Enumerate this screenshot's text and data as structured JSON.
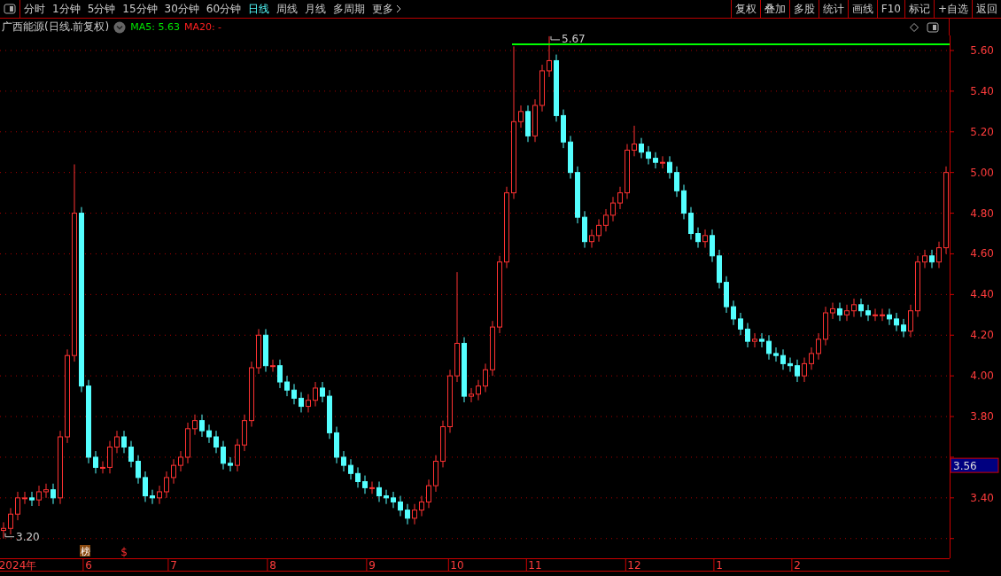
{
  "toolbar": {
    "periods": [
      {
        "label": "分时",
        "selected": false
      },
      {
        "label": "1分钟",
        "selected": false
      },
      {
        "label": "5分钟",
        "selected": false
      },
      {
        "label": "15分钟",
        "selected": false
      },
      {
        "label": "30分钟",
        "selected": false
      },
      {
        "label": "60分钟",
        "selected": false
      },
      {
        "label": "日线",
        "selected": true
      },
      {
        "label": "周线",
        "selected": false
      },
      {
        "label": "月线",
        "selected": false
      },
      {
        "label": "多周期",
        "selected": false
      }
    ],
    "more": "更多",
    "actions": [
      "复权",
      "叠加",
      "多股",
      "统计",
      "画线",
      "F10",
      "标记",
      "+自选",
      "返回"
    ]
  },
  "header": {
    "title": "广西能源(日线.前复权)",
    "indicators": [
      {
        "label": "MA5: 5.63",
        "color": "#00e600"
      },
      {
        "label": "MA20: -",
        "color": "#ff2020"
      }
    ]
  },
  "chart": {
    "chart_data": {
      "type": "candlestick",
      "grid": true,
      "ylim": [
        3.103,
        5.674
      ],
      "yticks": [
        {
          "value": 3.4,
          "label": "3.40"
        },
        {
          "value": 3.8,
          "label": "3.80"
        },
        {
          "value": 4.0,
          "label": "4.00"
        },
        {
          "value": 4.2,
          "label": "4.20"
        },
        {
          "value": 4.4,
          "label": "4.40"
        },
        {
          "value": 4.6,
          "label": "4.60"
        },
        {
          "value": 4.8,
          "label": "4.80"
        },
        {
          "value": 5.0,
          "label": "5.00"
        },
        {
          "value": 5.2,
          "label": "5.20"
        },
        {
          "value": 5.4,
          "label": "5.40"
        },
        {
          "value": 5.6,
          "label": "5.60"
        }
      ],
      "categories": [
        null,
        null,
        "2024年",
        null,
        null,
        null,
        null,
        null,
        null,
        null,
        null,
        null,
        "6",
        null,
        null,
        null,
        null,
        null,
        null,
        null,
        null,
        null,
        null,
        null,
        "7",
        null,
        null,
        null,
        null,
        null,
        null,
        null,
        null,
        null,
        null,
        null,
        null,
        null,
        "8",
        null,
        null,
        null,
        null,
        null,
        null,
        null,
        null,
        null,
        null,
        null,
        null,
        null,
        "9",
        null,
        null,
        null,
        null,
        null,
        null,
        null,
        null,
        null,
        null,
        null,
        "10",
        null,
        null,
        null,
        null,
        null,
        null,
        null,
        null,
        null,
        null,
        "11",
        null,
        null,
        null,
        null,
        null,
        null,
        null,
        null,
        null,
        null,
        null,
        null,
        null,
        "12",
        null,
        null,
        null,
        null,
        null,
        null,
        null,
        null,
        null,
        null,
        null,
        "1",
        null,
        null,
        null,
        null,
        null,
        null,
        null,
        null,
        null,
        null,
        "2",
        null,
        null,
        null,
        null,
        null,
        null,
        null,
        null,
        null,
        null,
        null,
        null,
        null,
        null,
        null,
        null,
        null,
        null,
        null,
        null,
        null
      ],
      "ohlc": [
        [
          3.24,
          3.28,
          3.2,
          3.25
        ],
        [
          3.25,
          3.35,
          3.22,
          3.32
        ],
        [
          3.32,
          3.43,
          3.29,
          3.4
        ],
        [
          3.4,
          3.43,
          3.37,
          3.4
        ],
        [
          3.4,
          3.43,
          3.36,
          3.39
        ],
        [
          3.39,
          3.46,
          3.36,
          3.43
        ],
        [
          3.43,
          3.47,
          3.4,
          3.44
        ],
        [
          3.44,
          3.47,
          3.37,
          3.4
        ],
        [
          3.4,
          3.73,
          3.37,
          3.7
        ],
        [
          3.7,
          4.13,
          3.67,
          4.1
        ],
        [
          4.1,
          5.04,
          4.07,
          4.8
        ],
        [
          4.8,
          4.83,
          3.92,
          3.95
        ],
        [
          3.95,
          3.98,
          3.57,
          3.6
        ],
        [
          3.6,
          3.63,
          3.52,
          3.55
        ],
        [
          3.55,
          3.58,
          3.52,
          3.55
        ],
        [
          3.55,
          3.68,
          3.52,
          3.65
        ],
        [
          3.65,
          3.73,
          3.62,
          3.7
        ],
        [
          3.7,
          3.73,
          3.62,
          3.65
        ],
        [
          3.65,
          3.68,
          3.55,
          3.58
        ],
        [
          3.58,
          3.61,
          3.47,
          3.5
        ],
        [
          3.5,
          3.53,
          3.38,
          3.41
        ],
        [
          3.41,
          3.44,
          3.37,
          3.4
        ],
        [
          3.4,
          3.46,
          3.37,
          3.43
        ],
        [
          3.43,
          3.53,
          3.4,
          3.5
        ],
        [
          3.5,
          3.59,
          3.47,
          3.56
        ],
        [
          3.56,
          3.63,
          3.53,
          3.6
        ],
        [
          3.6,
          3.77,
          3.57,
          3.74
        ],
        [
          3.74,
          3.81,
          3.71,
          3.78
        ],
        [
          3.78,
          3.81,
          3.7,
          3.73
        ],
        [
          3.73,
          3.76,
          3.67,
          3.7
        ],
        [
          3.7,
          3.73,
          3.62,
          3.65
        ],
        [
          3.65,
          3.68,
          3.54,
          3.57
        ],
        [
          3.57,
          3.6,
          3.53,
          3.56
        ],
        [
          3.56,
          3.69,
          3.53,
          3.66
        ],
        [
          3.66,
          3.81,
          3.63,
          3.78
        ],
        [
          3.78,
          4.07,
          3.75,
          4.04
        ],
        [
          4.04,
          4.23,
          4.01,
          4.2
        ],
        [
          4.2,
          4.23,
          4.02,
          4.05
        ],
        [
          4.05,
          4.08,
          4.02,
          4.05
        ],
        [
          4.05,
          4.08,
          3.94,
          3.97
        ],
        [
          3.97,
          4.0,
          3.9,
          3.93
        ],
        [
          3.93,
          3.96,
          3.86,
          3.89
        ],
        [
          3.89,
          3.92,
          3.82,
          3.85
        ],
        [
          3.85,
          3.91,
          3.82,
          3.88
        ],
        [
          3.88,
          3.97,
          3.85,
          3.94
        ],
        [
          3.94,
          3.97,
          3.87,
          3.9
        ],
        [
          3.9,
          3.93,
          3.69,
          3.72
        ],
        [
          3.72,
          3.75,
          3.57,
          3.6
        ],
        [
          3.6,
          3.63,
          3.53,
          3.56
        ],
        [
          3.56,
          3.59,
          3.49,
          3.52
        ],
        [
          3.52,
          3.55,
          3.45,
          3.48
        ],
        [
          3.48,
          3.51,
          3.42,
          3.45
        ],
        [
          3.45,
          3.48,
          3.42,
          3.45
        ],
        [
          3.45,
          3.48,
          3.38,
          3.41
        ],
        [
          3.41,
          3.44,
          3.37,
          3.4
        ],
        [
          3.4,
          3.43,
          3.35,
          3.38
        ],
        [
          3.38,
          3.41,
          3.31,
          3.34
        ],
        [
          3.34,
          3.37,
          3.27,
          3.3
        ],
        [
          3.3,
          3.37,
          3.27,
          3.34
        ],
        [
          3.34,
          3.41,
          3.31,
          3.38
        ],
        [
          3.38,
          3.49,
          3.35,
          3.46
        ],
        [
          3.46,
          3.61,
          3.43,
          3.58
        ],
        [
          3.58,
          3.78,
          3.55,
          3.75
        ],
        [
          3.75,
          4.03,
          3.72,
          4.0
        ],
        [
          4.0,
          4.51,
          3.97,
          4.16
        ],
        [
          4.16,
          4.19,
          3.87,
          3.9
        ],
        [
          3.9,
          3.94,
          3.87,
          3.91
        ],
        [
          3.91,
          3.98,
          3.88,
          3.95
        ],
        [
          3.95,
          4.06,
          3.92,
          4.03
        ],
        [
          4.03,
          4.27,
          4.0,
          4.24
        ],
        [
          4.24,
          4.59,
          4.21,
          4.56
        ],
        [
          4.56,
          4.93,
          4.53,
          4.9
        ],
        [
          4.9,
          5.62,
          4.87,
          5.25
        ],
        [
          5.25,
          5.33,
          5.22,
          5.3
        ],
        [
          5.3,
          5.33,
          5.15,
          5.18
        ],
        [
          5.18,
          5.36,
          5.15,
          5.33
        ],
        [
          5.33,
          5.53,
          5.3,
          5.5
        ],
        [
          5.5,
          5.67,
          5.47,
          5.55
        ],
        [
          5.55,
          5.58,
          5.25,
          5.28
        ],
        [
          5.28,
          5.31,
          5.12,
          5.15
        ],
        [
          5.15,
          5.18,
          4.97,
          5.0
        ],
        [
          5.0,
          5.03,
          4.75,
          4.78
        ],
        [
          4.78,
          4.81,
          4.63,
          4.66
        ],
        [
          4.66,
          4.72,
          4.63,
          4.69
        ],
        [
          4.69,
          4.77,
          4.66,
          4.74
        ],
        [
          4.74,
          4.82,
          4.71,
          4.79
        ],
        [
          4.79,
          4.88,
          4.76,
          4.85
        ],
        [
          4.85,
          4.93,
          4.82,
          4.9
        ],
        [
          4.9,
          5.14,
          4.87,
          5.11
        ],
        [
          5.11,
          5.23,
          5.08,
          5.14
        ],
        [
          5.14,
          5.17,
          5.07,
          5.1
        ],
        [
          5.1,
          5.13,
          5.04,
          5.07
        ],
        [
          5.07,
          5.1,
          5.02,
          5.05
        ],
        [
          5.05,
          5.08,
          5.02,
          5.05
        ],
        [
          5.05,
          5.08,
          4.97,
          5.0
        ],
        [
          5.0,
          5.03,
          4.88,
          4.91
        ],
        [
          4.91,
          4.94,
          4.77,
          4.8
        ],
        [
          4.8,
          4.83,
          4.67,
          4.7
        ],
        [
          4.7,
          4.73,
          4.63,
          4.66
        ],
        [
          4.66,
          4.72,
          4.63,
          4.69
        ],
        [
          4.69,
          4.72,
          4.56,
          4.59
        ],
        [
          4.59,
          4.62,
          4.43,
          4.46
        ],
        [
          4.46,
          4.49,
          4.31,
          4.34
        ],
        [
          4.34,
          4.37,
          4.25,
          4.28
        ],
        [
          4.28,
          4.31,
          4.2,
          4.23
        ],
        [
          4.23,
          4.26,
          4.14,
          4.17
        ],
        [
          4.17,
          4.21,
          4.14,
          4.18
        ],
        [
          4.18,
          4.21,
          4.14,
          4.17
        ],
        [
          4.17,
          4.2,
          4.08,
          4.11
        ],
        [
          4.11,
          4.14,
          4.07,
          4.1
        ],
        [
          4.1,
          4.13,
          4.03,
          4.06
        ],
        [
          4.06,
          4.09,
          4.02,
          4.05
        ],
        [
          4.05,
          4.08,
          3.97,
          4.0
        ],
        [
          4.0,
          4.09,
          3.97,
          4.06
        ],
        [
          4.06,
          4.14,
          4.03,
          4.11
        ],
        [
          4.11,
          4.21,
          4.08,
          4.18
        ],
        [
          4.18,
          4.34,
          4.15,
          4.31
        ],
        [
          4.31,
          4.36,
          4.28,
          4.33
        ],
        [
          4.33,
          4.36,
          4.27,
          4.3
        ],
        [
          4.3,
          4.35,
          4.27,
          4.32
        ],
        [
          4.32,
          4.38,
          4.29,
          4.35
        ],
        [
          4.35,
          4.38,
          4.29,
          4.32
        ],
        [
          4.32,
          4.35,
          4.27,
          4.3
        ],
        [
          4.3,
          4.33,
          4.27,
          4.3
        ],
        [
          4.3,
          4.33,
          4.27,
          4.3
        ],
        [
          4.3,
          4.33,
          4.25,
          4.28
        ],
        [
          4.28,
          4.31,
          4.22,
          4.25
        ],
        [
          4.25,
          4.28,
          4.19,
          4.22
        ],
        [
          4.22,
          4.35,
          4.19,
          4.32
        ],
        [
          4.32,
          4.59,
          4.29,
          4.56
        ],
        [
          4.56,
          4.62,
          4.53,
          4.59
        ],
        [
          4.59,
          4.62,
          4.53,
          4.56
        ],
        [
          4.56,
          4.66,
          4.53,
          4.63
        ],
        [
          4.63,
          5.03,
          4.6,
          5.0
        ]
      ],
      "annotations": [
        "5.67",
        "3.20",
        "3.56"
      ]
    },
    "markers": [
      {
        "label": "榜",
        "kind": "badge"
      },
      {
        "label": "$",
        "kind": "symbol"
      }
    ]
  }
}
